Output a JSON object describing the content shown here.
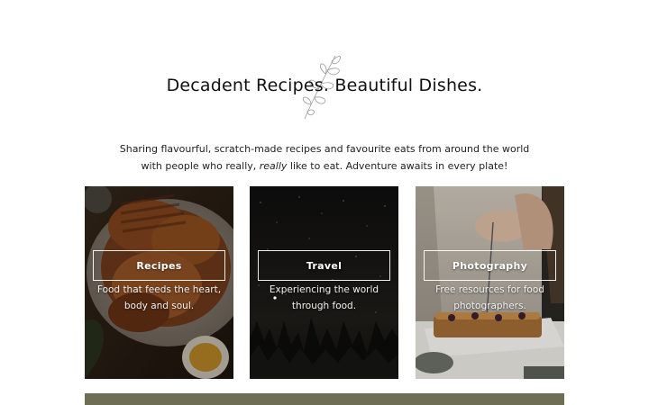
{
  "hero": {
    "headline": "Decadent Recipes. Beautiful Dishes.",
    "intro_part1": "Sharing flavourful, scratch-made recipes and favourite eats from around the world with people who really, ",
    "intro_emphasis": "really",
    "intro_part2": " like to eat. Adventure awaits in every plate!",
    "decoration_icon": "olive-sprig-icon"
  },
  "cards": [
    {
      "title": "Recipes",
      "description": "Food that feeds the heart, body and soul.",
      "image": "roast-chicken-platter"
    },
    {
      "title": "Travel",
      "description": "Experiencing the world through food.",
      "image": "night-sky-forest"
    },
    {
      "title": "Photography",
      "description": "Free resources for food photographers.",
      "image": "hands-plating-tart"
    }
  ],
  "colors": {
    "bottom_bar": "#6e6e55",
    "card_overlay_text": "#ffffff"
  }
}
